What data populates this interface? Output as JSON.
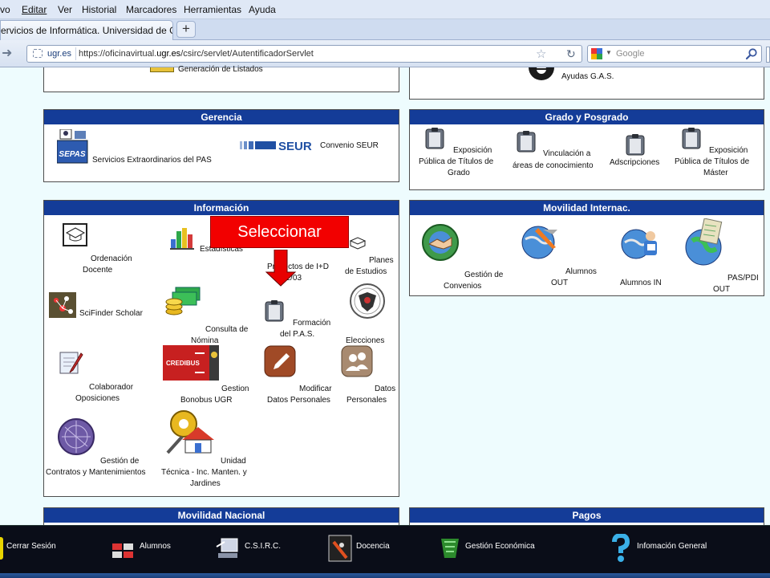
{
  "menubar": {
    "items": [
      "vo",
      "Editar",
      "Ver",
      "Historial",
      "Marcadores",
      "Herramientas",
      "Ayuda"
    ]
  },
  "tabs": {
    "active_title": "ervicios de Informática. Universidad de Gra...",
    "new_tab_label": "+"
  },
  "navbar": {
    "identity_label": "ugr.es",
    "url_prefix": "https://oficinavirtual.",
    "url_domain": "ugr.es",
    "url_path": "/csirc/servlet/AutentificadorServlet",
    "search_placeholder": "Google",
    "icons": [
      "forward-icon",
      "star-icon",
      "reload-icon",
      "google-icon",
      "search-icon"
    ]
  },
  "panels": {
    "top_left": {
      "item": "Generación de Listados"
    },
    "top_right": {
      "item": "Ayudas G.A.S."
    },
    "gerencia": {
      "title": "Gerencia",
      "items": [
        "Servicios Extraordinarios del PAS",
        "Convenio SEUR"
      ],
      "sepas_logo": "SEPAS",
      "seur_logo": "SEUR"
    },
    "grado": {
      "title": "Grado y Posgrado",
      "items": [
        [
          "Exposición",
          "Pública de Títulos de",
          "Grado"
        ],
        [
          "Vinculación a",
          "áreas de conocimiento"
        ],
        [
          "Adscripciones"
        ],
        [
          "Exposición",
          "Pública de Títulos de",
          "Máster"
        ]
      ]
    },
    "informacion": {
      "title": "Información",
      "items": {
        "ordenacion": [
          "Ordenación",
          "Docente"
        ],
        "estadisticas": [
          "Estadísticas"
        ],
        "proyectos": [
          "Proyectos de I+D",
          "02/03"
        ],
        "planes": [
          "Planes",
          "de Estudios"
        ],
        "scifinder": [
          "SciFinder Scholar"
        ],
        "nomina": [
          "Consulta de",
          "Nómina"
        ],
        "formacion": [
          "Formación",
          "del P.A.S."
        ],
        "elecciones": [
          "Elecciones"
        ],
        "colaborador": [
          "Colaborador",
          "Oposiciones"
        ],
        "bonobus": [
          "Gestion",
          "Bonobus UGR"
        ],
        "modificar": [
          "Modificar",
          "Datos Personales"
        ],
        "datos": [
          "Datos",
          "Personales"
        ],
        "contratos": [
          "Gestión de",
          "Contratos y Mantenimientos"
        ],
        "unidad": [
          "Unidad",
          "Técnica - Inc. Manten. y",
          "Jardines"
        ]
      },
      "credibus_logo": "CREDIBUS"
    },
    "movilidad_internac": {
      "title": "Movilidad Internac.",
      "items": {
        "convenios": [
          "Gestión de",
          "Convenios"
        ],
        "alumnos_out": [
          "Alumnos",
          "OUT"
        ],
        "alumnos_in": [
          "Alumnos IN"
        ],
        "pas_pdi": [
          "PAS/PDI",
          "OUT"
        ]
      }
    },
    "movilidad_nacional": {
      "title": "Movilidad Nacional"
    },
    "pagos": {
      "title": "Pagos"
    }
  },
  "annotation": {
    "label": "Seleccionar",
    "color": "#f20000"
  },
  "bottombar": {
    "items": [
      "Cerrar Sesión",
      "Alumnos",
      "C.S.I.R.C.",
      "Docencia",
      "Gestión Económica",
      "Infomación General"
    ]
  },
  "colors": {
    "panel_header": "#143c98",
    "page_bg": "#eefcfe",
    "taskbar_bg": "#0a0d18"
  }
}
